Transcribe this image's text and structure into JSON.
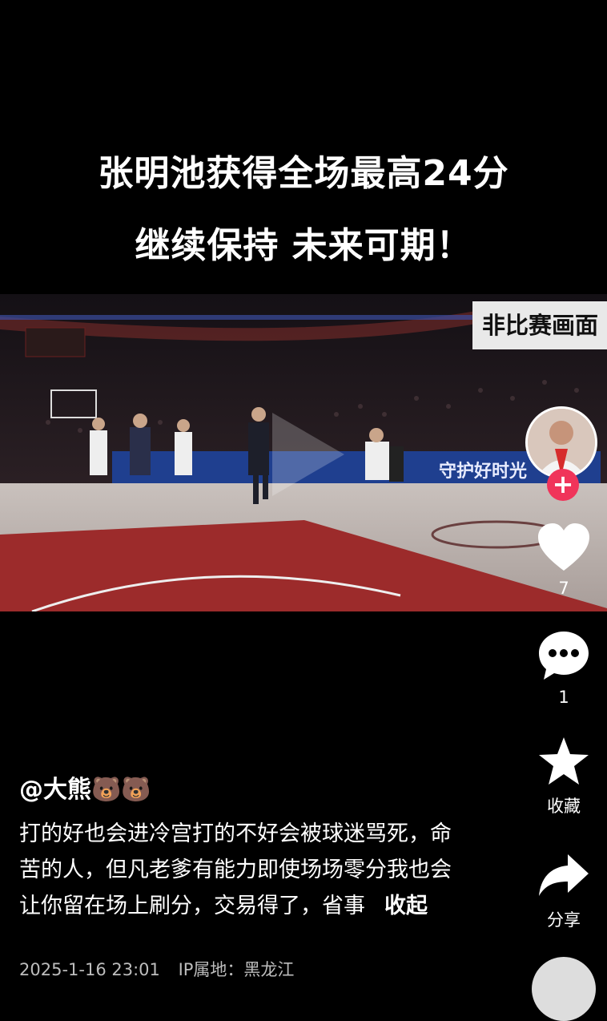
{
  "headline": {
    "line1": "张明池获得全场最高24分",
    "line2": "继续保持 未来可期！"
  },
  "video": {
    "watermark": "非比赛画面",
    "banner_text": "守护好时光"
  },
  "actions": {
    "follow_symbol": "+",
    "like_count": "7",
    "comment_count": "1",
    "favorite_label": "收藏",
    "share_label": "分享"
  },
  "post": {
    "author": "@大熊🐻🐻",
    "description": "打的好也会进冷宫打的不好会被球迷骂死，命苦的人，但凡老爹有能力即使场场零分我也会让你留在场上刷分，交易得了，省事",
    "collapse_label": "收起",
    "date": "2025-1-16 23:01",
    "ip_location": "IP属地：黑龙江"
  },
  "colors": {
    "background": "#000000",
    "follow_button": "#f0345a",
    "text": "#ffffff"
  }
}
